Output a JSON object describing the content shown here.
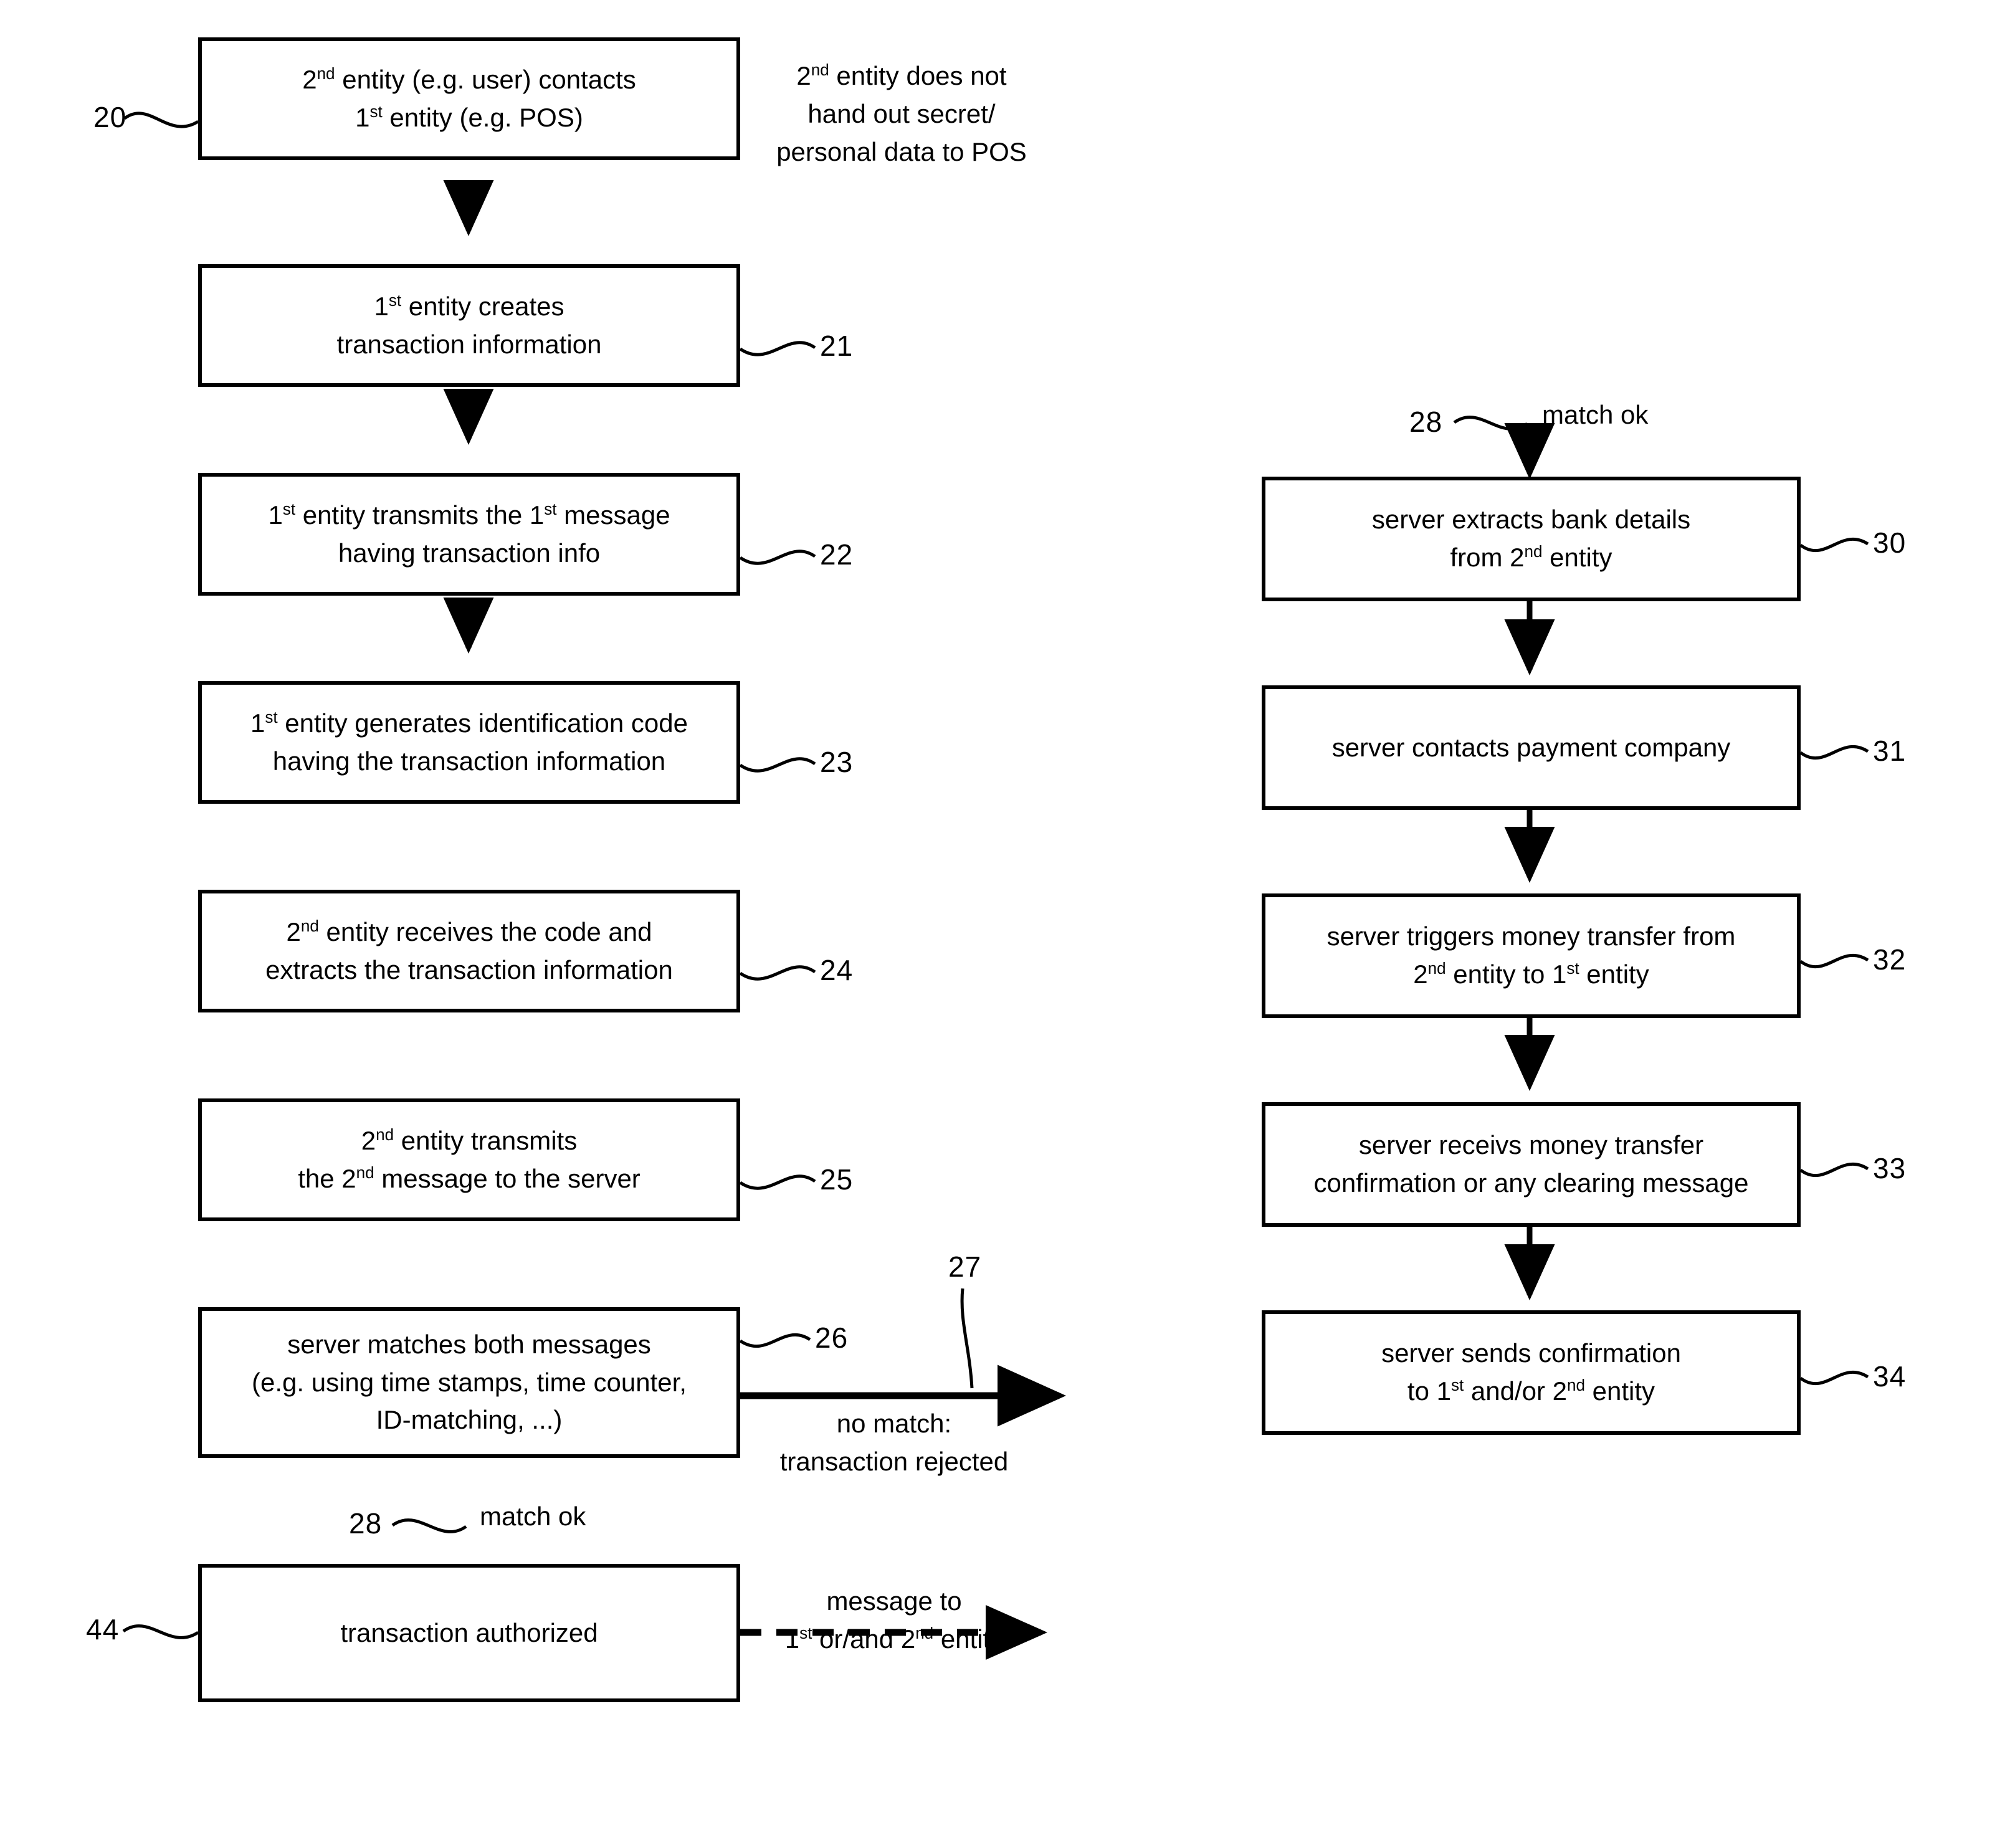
{
  "figure": {
    "type": "patent-flowchart",
    "title": "",
    "orientation": "two-column"
  },
  "left_column": {
    "steps": [
      {
        "ref": "20",
        "ref_side": "left",
        "lines": [
          "2<sup>nd</sup> entity (e.g. user) contacts",
          "1<sup>st</sup> entity (e.g. POS)"
        ],
        "plain": "2nd entity (e.g. user) contacts 1st entity (e.g. POS)"
      },
      {
        "ref": "21",
        "ref_side": "right",
        "lines": [
          "1<sup>st</sup> entity creates",
          "transaction information"
        ],
        "plain": "1st entity creates transaction information"
      },
      {
        "ref": "22",
        "ref_side": "right",
        "lines": [
          "1<sup>st</sup> entity transmits the 1<sup>st</sup> message",
          "having transaction info"
        ],
        "plain": "1st entity transmits the 1st message having transaction info"
      },
      {
        "ref": "23",
        "ref_side": "right",
        "lines": [
          "1<sup>st</sup> entity generates identification code",
          "having the transaction information"
        ],
        "plain": "1st entity generates identification code having the transaction information"
      },
      {
        "ref": "24",
        "ref_side": "right",
        "lines": [
          "2<sup>nd</sup> entity receives the code and",
          "extracts the transaction information"
        ],
        "plain": "2nd entity receives the code and extracts the transaction information"
      },
      {
        "ref": "25",
        "ref_side": "right",
        "lines": [
          "2<sup>nd</sup> entity transmits",
          "the 2<sup>nd</sup> message to the server"
        ],
        "plain": "2nd entity transmits the 2nd message to the server"
      },
      {
        "ref": "26",
        "ref_side": "right",
        "lines": [
          "server matches both messages",
          "(e.g. using time stamps, time counter,",
          "ID-matching, ...)"
        ],
        "plain": "server matches both messages (e.g. using time stamps, time counter, ID-matching, ...)"
      },
      {
        "ref": "44",
        "ref_side": "left",
        "lines": [
          "transaction authorized"
        ],
        "plain": "transaction authorized"
      }
    ]
  },
  "right_column": {
    "steps": [
      {
        "ref": "30",
        "ref_side": "right",
        "lines": [
          "server extracts bank details",
          "from 2<sup>nd</sup> entity"
        ],
        "plain": "server extracts bank details from 2nd entity"
      },
      {
        "ref": "31",
        "ref_side": "right",
        "lines": [
          "server contacts payment company"
        ],
        "plain": "server contacts payment company"
      },
      {
        "ref": "32",
        "ref_side": "right",
        "lines": [
          "server triggers money transfer from",
          "2<sup>nd</sup> entity to 1<sup>st</sup> entity"
        ],
        "plain": "server triggers money transfer from 2nd entity to 1st entity"
      },
      {
        "ref": "33",
        "ref_side": "right",
        "lines": [
          "server receivs money transfer",
          "confirmation or any clearing message"
        ],
        "plain": "server receivs money transfer confirmation or any clearing message"
      },
      {
        "ref": "34",
        "ref_side": "right",
        "lines": [
          "server sends confirmation",
          "to 1<sup>st</sup> and/or 2<sup>nd</sup> entity"
        ],
        "plain": "server sends confirmation to 1st and/or 2nd entity"
      }
    ]
  },
  "annotations": {
    "pos_privacy_note": "2<sup>nd</sup> entity does not\nhand out secret/\npersonal data to POS",
    "pos_privacy_note_plain": "2nd entity does not hand out secret/ personal data to POS",
    "no_match_label": "no match:\ntransaction rejected",
    "no_match_ref": "27",
    "match_ok_label_left": "match ok",
    "match_ok_ref_left": "28",
    "match_ok_label_right": "match ok",
    "match_ok_ref_right": "28",
    "message_to_label": "message to\n1<sup>st</sup> or/and 2<sup>nd</sup> entity",
    "message_to_label_plain": "message to 1st or/and 2nd entity"
  },
  "style": {
    "stroke": "#000000",
    "fill": "#ffffff",
    "background": "#ffffff"
  }
}
